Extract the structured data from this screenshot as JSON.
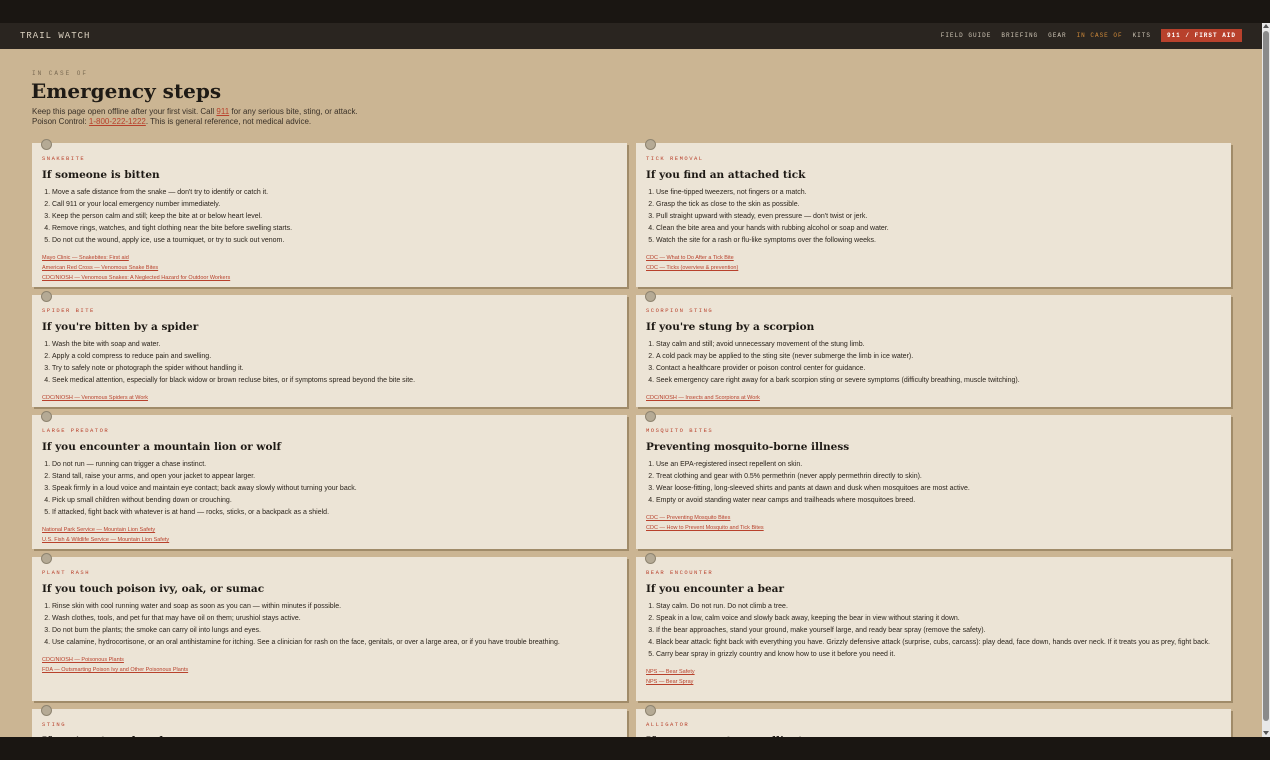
{
  "nav": {
    "brand": "TRAIL WATCH",
    "links": [
      "FIELD GUIDE",
      "BRIEFING",
      "GEAR",
      "IN CASE OF",
      "KITS"
    ],
    "cta": "911 / FIRST AID"
  },
  "header": {
    "eyebrow": "IN CASE OF",
    "title": "Emergency steps",
    "intro_part1": "Keep this page open offline after your first visit. Call ",
    "intro_911": "911",
    "intro_part2": " for any serious bite, sting, or attack. Poison Control: ",
    "intro_phone": "1-800-222-1222",
    "intro_part3": ". This is general reference, not medical advice."
  },
  "cards": [
    {
      "label": "SNAKEBITE",
      "title": "If someone is bitten",
      "steps": [
        "Move a safe distance from the snake — don't try to identify or catch it.",
        "Call 911 or your local emergency number immediately.",
        "Keep the person calm and still; keep the bite at or below heart level.",
        "Remove rings, watches, and tight clothing near the bite before swelling starts.",
        "Do not cut the wound, apply ice, use a tourniquet, or try to suck out venom."
      ],
      "links": [
        "Mayo Clinic — Snakebites: First aid",
        "American Red Cross — Venomous Snake Bites",
        "CDC/NIOSH — Venomous Snakes: A Neglected Hazard for Outdoor Workers"
      ]
    },
    {
      "label": "TICK REMOVAL",
      "title": "If you find an attached tick",
      "steps": [
        "Use fine-tipped tweezers, not fingers or a match.",
        "Grasp the tick as close to the skin as possible.",
        "Pull straight upward with steady, even pressure — don't twist or jerk.",
        "Clean the bite area and your hands with rubbing alcohol or soap and water.",
        "Watch the site for a rash or flu-like symptoms over the following weeks."
      ],
      "links": [
        "CDC — What to Do After a Tick Bite",
        "CDC — Ticks (overview & prevention)"
      ]
    },
    {
      "label": "SPIDER BITE",
      "title": "If you're bitten by a spider",
      "steps": [
        "Wash the bite with soap and water.",
        "Apply a cold compress to reduce pain and swelling.",
        "Try to safely note or photograph the spider without handling it.",
        "Seek medical attention, especially for black widow or brown recluse bites, or if symptoms spread beyond the bite site."
      ],
      "links": [
        "CDC/NIOSH — Venomous Spiders at Work"
      ]
    },
    {
      "label": "SCORPION STING",
      "title": "If you're stung by a scorpion",
      "steps": [
        "Stay calm and still; avoid unnecessary movement of the stung limb.",
        "A cold pack may be applied to the sting site (never submerge the limb in ice water).",
        "Contact a healthcare provider or poison control center for guidance.",
        "Seek emergency care right away for a bark scorpion sting or severe symptoms (difficulty breathing, muscle twitching)."
      ],
      "links": [
        "CDC/NIOSH — Insects and Scorpions at Work"
      ]
    },
    {
      "label": "LARGE PREDATOR",
      "title": "If you encounter a mountain lion or wolf",
      "steps": [
        "Do not run — running can trigger a chase instinct.",
        "Stand tall, raise your arms, and open your jacket to appear larger.",
        "Speak firmly in a loud voice and maintain eye contact; back away slowly without turning your back.",
        "Pick up small children without bending down or crouching.",
        "If attacked, fight back with whatever is at hand — rocks, sticks, or a backpack as a shield."
      ],
      "links": [
        "National Park Service — Mountain Lion Safety",
        "U.S. Fish & Wildlife Service — Mountain Lion Safety"
      ]
    },
    {
      "label": "MOSQUITO BITES",
      "title": "Preventing mosquito-borne illness",
      "steps": [
        "Use an EPA-registered insect repellent on skin.",
        "Treat clothing and gear with 0.5% permethrin (never apply permethrin directly to skin).",
        "Wear loose-fitting, long-sleeved shirts and pants at dawn and dusk when mosquitoes are most active.",
        "Empty or avoid standing water near camps and trailheads where mosquitoes breed."
      ],
      "links": [
        "CDC — Preventing Mosquito Bites",
        "CDC — How to Prevent Mosquito and Tick Bites"
      ]
    },
    {
      "label": "PLANT RASH",
      "title": "If you touch poison ivy, oak, or sumac",
      "steps": [
        "Rinse skin with cool running water and soap as soon as you can — within minutes if possible.",
        "Wash clothes, tools, and pet fur that may have oil on them; urushiol stays active.",
        "Do not burn the plants; the smoke can carry oil into lungs and eyes.",
        "Use calamine, hydrocortisone, or an oral antihistamine for itching. See a clinician for rash on the face, genitals, or over a large area, or if you have trouble breathing."
      ],
      "links": [
        "CDC/NIOSH — Poisonous Plants",
        "FDA — Outsmarting Poison Ivy and Other Poisonous Plants"
      ]
    },
    {
      "label": "BEAR ENCOUNTER",
      "title": "If you encounter a bear",
      "steps": [
        "Stay calm. Do not run. Do not climb a tree.",
        "Speak in a low, calm voice and slowly back away, keeping the bear in view without staring it down.",
        "If the bear approaches, stand your ground, make yourself large, and ready bear spray (remove the safety).",
        "Black bear attack: fight back with everything you have. Grizzly defensive attack (surprise, cubs, carcass): play dead, face down, hands over neck. If it treats you as prey, fight back.",
        "Carry bear spray in grizzly country and know how to use it before you need it."
      ],
      "links": [
        "NPS — Bear Safety",
        "NPS — Bear Spray"
      ]
    },
    {
      "label": "STING",
      "title": "If you're stung by a bee or wasp",
      "steps": [],
      "links": []
    },
    {
      "label": "ALLIGATOR",
      "title": "If you encounter an alligator",
      "steps": [],
      "links": []
    }
  ]
}
